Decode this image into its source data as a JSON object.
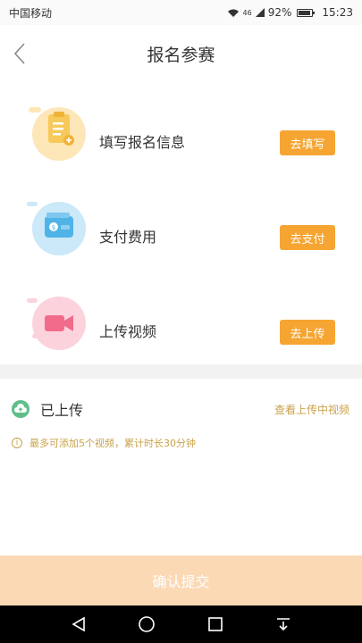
{
  "status_bar": {
    "carrier": "中国移动",
    "network": "46",
    "battery": "92%",
    "time": "15:23"
  },
  "header": {
    "title": "报名参赛"
  },
  "steps": [
    {
      "label": "填写报名信息",
      "action": "去填写",
      "icon": "clipboard-icon",
      "color": "#f7c95a"
    },
    {
      "label": "支付费用",
      "action": "去支付",
      "icon": "wallet-icon",
      "color": "#4fb3e8"
    },
    {
      "label": "上传视频",
      "action": "去上传",
      "icon": "video-camera-icon",
      "color": "#f26b8a"
    }
  ],
  "uploaded": {
    "title": "已上传",
    "view_link": "查看上传中视频",
    "tip": "最多可添加5个视频，累计时长30分钟"
  },
  "submit": {
    "label": "确认提交"
  },
  "colors": {
    "accent": "#f6a532",
    "link": "#c9a24a",
    "cloud": "#5fbf8a"
  }
}
